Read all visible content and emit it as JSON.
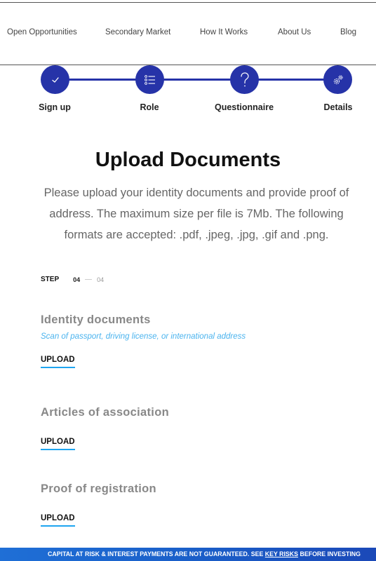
{
  "nav": {
    "items": [
      "Open Opportunities",
      "Secondary Market",
      "How It Works",
      "About Us",
      "Blog"
    ]
  },
  "stepper": {
    "steps": [
      {
        "label": "Sign up",
        "icon": "check-icon"
      },
      {
        "label": "Role",
        "icon": "list-icon"
      },
      {
        "label": "Questionnaire",
        "icon": "question-icon"
      },
      {
        "label": "Details",
        "icon": "gears-icon"
      }
    ],
    "accent": "#2633a8"
  },
  "main": {
    "title": "Upload Documents",
    "description": "Please upload your identity documents and provide proof of address. The maximum size per file is 7Mb. The following formats are accepted: .pdf, .jpeg, .jpg, .gif and .png.",
    "step_counter": {
      "label": "STEP",
      "current": "04",
      "total": "04"
    },
    "documents": [
      {
        "title": "Identity documents",
        "hint": "Scan of passport, driving license, or international address",
        "upload_label": "UPLOAD"
      },
      {
        "title": "Articles of association",
        "hint": "",
        "upload_label": "UPLOAD"
      },
      {
        "title": "Proof of registration",
        "hint": "",
        "upload_label": "UPLOAD"
      }
    ]
  },
  "banner": {
    "text_before": "CAPITAL AT RISK & INTEREST PAYMENTS ARE NOT GUARANTEED. SEE ",
    "link": "KEY RISKS",
    "text_after": " BEFORE INVESTING"
  }
}
